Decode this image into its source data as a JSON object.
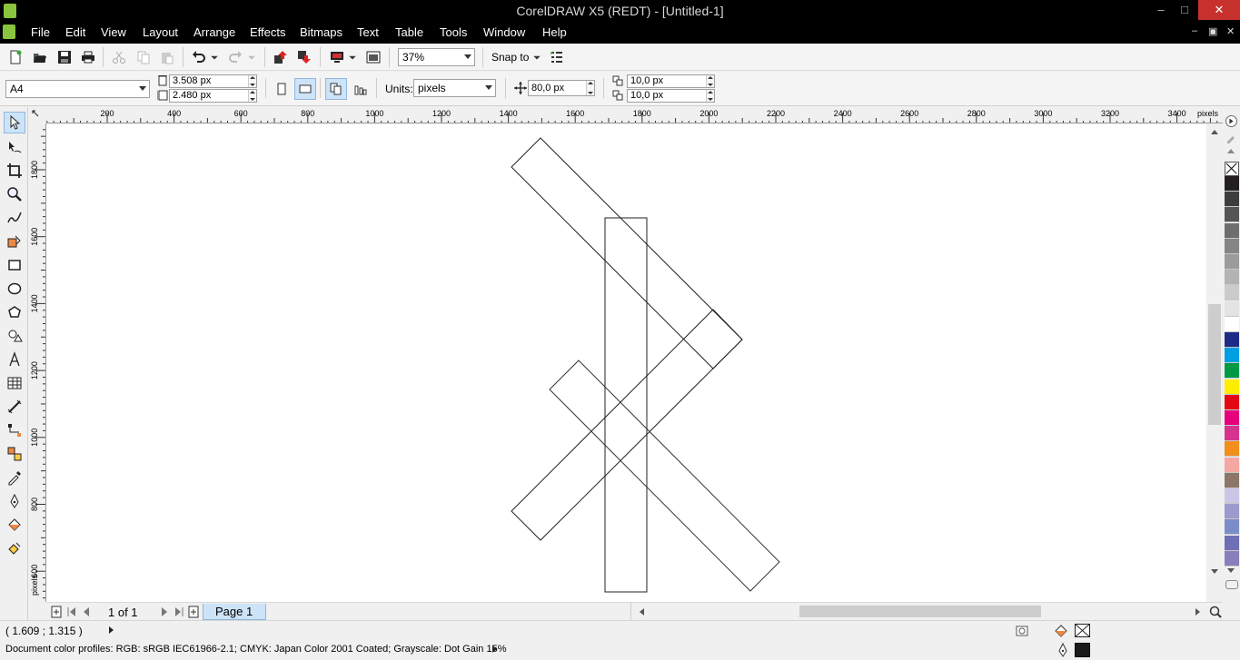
{
  "window": {
    "title": "CorelDRAW X5 (REDT) - [Untitled-1]",
    "minimize": "–",
    "maximize": "□",
    "close": "✕"
  },
  "menu": [
    "File",
    "Edit",
    "View",
    "Layout",
    "Arrange",
    "Effects",
    "Bitmaps",
    "Text",
    "Table",
    "Tools",
    "Window",
    "Help"
  ],
  "doc_controls": {
    "minimize": "–",
    "restore": "▣",
    "close": "✕"
  },
  "standard_toolbar": {
    "zoom_value": "37%",
    "snap_label": "Snap to"
  },
  "property_bar": {
    "page_size": "A4",
    "width": "3.508 px",
    "height": "2.480 px",
    "units_label": "Units:",
    "units_value": "pixels",
    "nudge": "80,0 px",
    "dup_x": "10,0 px",
    "dup_y": "10,0 px"
  },
  "rulers": {
    "h_ticks": [
      "200",
      "400",
      "600",
      "800",
      "1000",
      "1200",
      "1400",
      "1600",
      "1800",
      "2000",
      "2200",
      "2400",
      "2600",
      "2800",
      "3000",
      "3200",
      "3400"
    ],
    "h_unit": "pixels",
    "v_ticks": [
      "1800",
      "1600",
      "1400",
      "1200",
      "1000",
      "800",
      "600"
    ],
    "v_unit": "pixels"
  },
  "page_nav": {
    "counter": "1 of 1",
    "tab": "Page 1"
  },
  "status": {
    "coords": "( 1.609 ; 1.315 )",
    "profiles": "Document color profiles: RGB: sRGB IEC61966-2.1; CMYK: Japan Color 2001 Coated; Grayscale: Dot Gain 15%",
    "fill_color": "#ffffff",
    "outline_color": "#1a1a1a"
  },
  "palette": [
    "#231f20",
    "#3d3d3d",
    "#555555",
    "#6e6e6e",
    "#858585",
    "#9b9b9b",
    "#b3b3b3",
    "#cbcbcb",
    "#e3e3e3",
    "#ffffff",
    "#1d2a86",
    "#009fe3",
    "#009a44",
    "#ffed00",
    "#e30613",
    "#e6007e",
    "#d6338f",
    "#f18e1c",
    "#f4a7a3",
    "#8b7667",
    "#c9c6e6",
    "#9c99cc",
    "#7b8dc8",
    "#6f6fb5",
    "#8a7fbb"
  ]
}
